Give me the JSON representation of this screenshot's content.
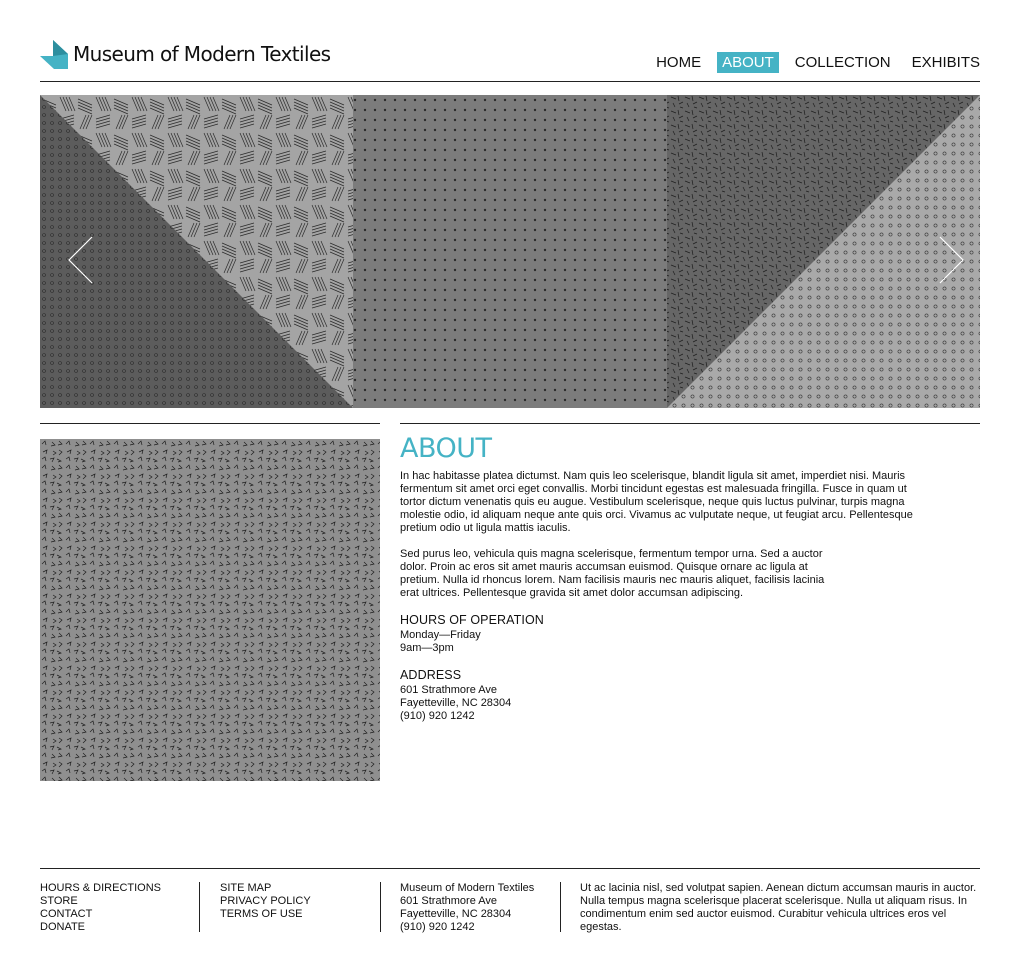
{
  "brand": {
    "name": "Museum of Modern Textiles",
    "accent_color": "#45b3c5"
  },
  "nav": {
    "items": [
      {
        "label": "HOME",
        "active": false
      },
      {
        "label": "ABOUT",
        "active": true
      },
      {
        "label": "COLLECTION",
        "active": false
      },
      {
        "label": "EXHIBITS",
        "active": false
      }
    ]
  },
  "hero": {
    "prev_icon": "chevron-left-icon",
    "next_icon": "chevron-right-icon"
  },
  "about": {
    "title": "ABOUT",
    "paragraph1": "In hac habitasse platea dictumst. Nam quis leo scelerisque, blandit ligula sit amet, imperdiet nisi. Mauris fermentum sit amet orci eget convallis. Morbi tincidunt egestas est malesuada fringilla. Fusce in quam ut tortor dictum venenatis quis eu augue. Vestibulum scelerisque, neque quis luctus pulvinar, turpis magna molestie odio, id aliquam neque ante quis orci. Vivamus ac vulputate neque, ut feugiat arcu. Pellentesque pretium odio ut ligula mattis iaculis.",
    "paragraph2": "Sed purus leo, vehicula quis magna scelerisque, fermentum tempor urna. Sed a auctor dolor. Proin ac eros sit amet mauris accumsan euismod. Quisque ornare ac ligula at pretium. Nulla id rhoncus lorem. Nam facilisis mauris nec mauris aliquet, facilisis lacinia erat ultrices. Pellentesque gravida sit amet dolor accumsan adipiscing.",
    "hours_heading": "HOURS OF OPERATION",
    "hours_days": "Monday—Friday",
    "hours_time": "9am—3pm",
    "address_heading": "ADDRESS",
    "address_line1": "601 Strathmore Ave",
    "address_line2": "Fayetteville, NC 28304",
    "address_phone": "(910) 920 1242"
  },
  "footer": {
    "col1": [
      "HOURS & DIRECTIONS",
      "STORE",
      "CONTACT",
      "DONATE"
    ],
    "col2": [
      "SITE MAP",
      "PRIVACY POLICY",
      "TERMS OF USE"
    ],
    "col3": [
      "Museum of Modern Textiles",
      "601 Strathmore Ave",
      "Fayetteville, NC 28304",
      "(910) 920 1242"
    ],
    "col4": "Ut ac lacinia nisl, sed volutpat sapien. Aenean dictum accumsan mauris in auctor. Nulla tempus magna scelerisque placerat scelerisque. Nulla ut aliquam risus. In condimentum enim sed auctor euismod. Curabitur vehicula ultrices eros vel egestas."
  }
}
